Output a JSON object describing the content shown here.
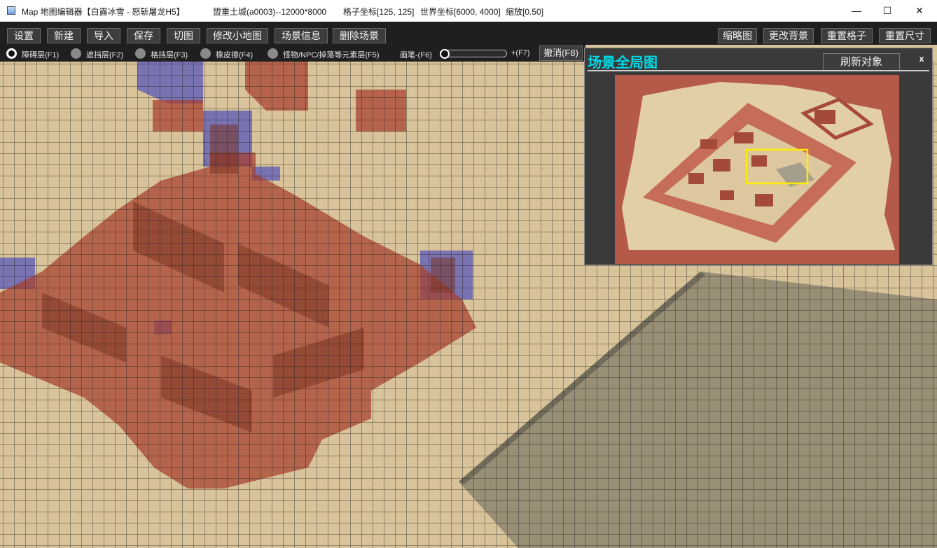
{
  "window": {
    "title": "Map 地图编辑器【白露冰雪 - 怒斩屠龙H5】",
    "map_name": "盟重土城(a0003)--12000*8000",
    "grid_coord": "格子坐标[125, 125]",
    "world_coord": "世界坐标[6000, 4000]",
    "zoom": "缩放[0.50]",
    "controls": {
      "minimize": "—",
      "maximize": "☐",
      "close": "✕"
    }
  },
  "toolbar": {
    "left": [
      "设置",
      "新建",
      "导入",
      "保存",
      "切图",
      "修改小地图",
      "场景信息",
      "删除场景"
    ],
    "right": [
      "缩略图",
      "更改背景",
      "重置格子",
      "重置尺寸"
    ]
  },
  "layers": {
    "items": [
      {
        "label": "障碍层(F1)",
        "selected": true
      },
      {
        "label": "遮挡层(F2)",
        "selected": false
      },
      {
        "label": "格挡层(F3)",
        "selected": false
      },
      {
        "label": "橡皮擦(F4)",
        "selected": false
      },
      {
        "label": "怪物/NPC/掉落等元素层(F5)",
        "selected": false
      }
    ],
    "brush_minus": "画笔-(F6)",
    "brush_plus": "+(F7)",
    "brush_level": 0.0,
    "undo": "撤消(F8)"
  },
  "overview": {
    "title": "场景全局图",
    "refresh": "刷新对象",
    "close": "x"
  },
  "colors": {
    "obstacle": "#a8402e",
    "occlusion": "#5a58b8",
    "sand": "#d8c39a",
    "grid": "#1a1a1a",
    "panel_title": "#00d8e6",
    "viewport_box": "#ffee00"
  }
}
